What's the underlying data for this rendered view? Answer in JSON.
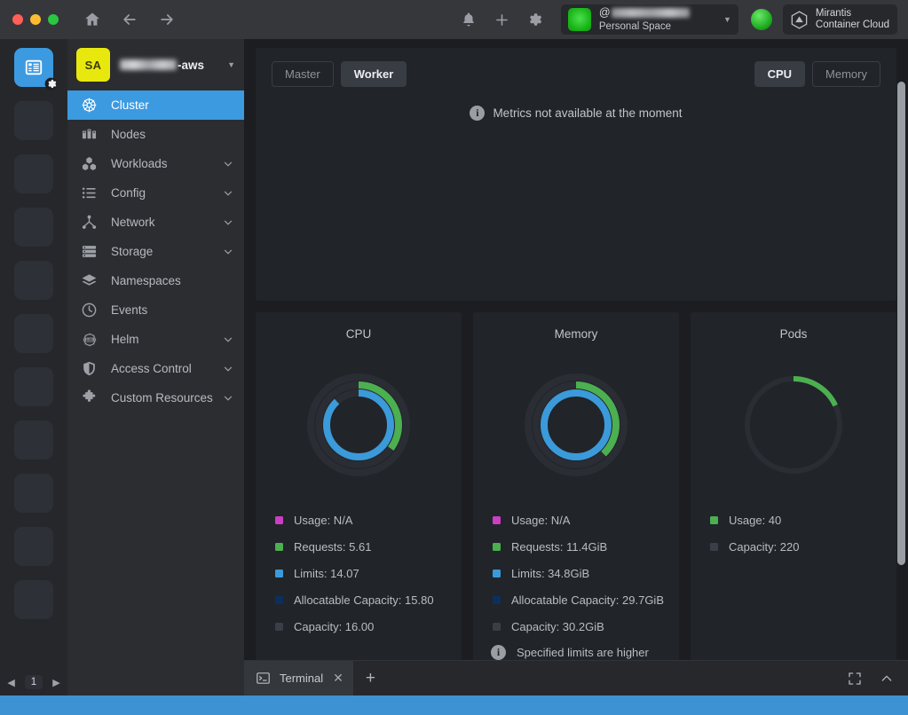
{
  "titlebar": {
    "nav": [
      {
        "name": "home-icon",
        "label": "Home"
      },
      {
        "name": "back-icon",
        "label": "Back"
      },
      {
        "name": "forward-icon",
        "label": "Forward"
      }
    ],
    "icons": [
      {
        "name": "bell-icon",
        "label": "Notifications"
      },
      {
        "name": "plus-icon",
        "label": "Add"
      },
      {
        "name": "gear-icon",
        "label": "Preferences"
      }
    ],
    "workspace": {
      "at_symbol": "@",
      "user_masked": true,
      "subtitle": "Personal Space",
      "caret": "▼"
    },
    "brand": {
      "line1": "Mirantis",
      "line2": "Container Cloud"
    }
  },
  "rail": {
    "active_icon": "list-icon",
    "badge_icon": "gear-icon",
    "placeholder_count": 10,
    "pager": {
      "prev": "◀",
      "page": "1",
      "next": "▶"
    }
  },
  "sidebar": {
    "cluster": {
      "avatar_initials": "SA",
      "avatar_color": "#e8e80f",
      "name_suffix": "-aws",
      "caret": "▼"
    },
    "items": [
      {
        "label": "Cluster",
        "icon": "helm-wheel-icon",
        "active": true,
        "expandable": false
      },
      {
        "label": "Nodes",
        "icon": "nodes-icon",
        "active": false,
        "expandable": false
      },
      {
        "label": "Workloads",
        "icon": "workloads-icon",
        "active": false,
        "expandable": true
      },
      {
        "label": "Config",
        "icon": "config-list-icon",
        "active": false,
        "expandable": true
      },
      {
        "label": "Network",
        "icon": "network-icon",
        "active": false,
        "expandable": true
      },
      {
        "label": "Storage",
        "icon": "storage-icon",
        "active": false,
        "expandable": true
      },
      {
        "label": "Namespaces",
        "icon": "layers-icon",
        "active": false,
        "expandable": false
      },
      {
        "label": "Events",
        "icon": "clock-icon",
        "active": false,
        "expandable": false
      },
      {
        "label": "Helm",
        "icon": "helm-icon",
        "active": false,
        "expandable": true
      },
      {
        "label": "Access Control",
        "icon": "shield-icon",
        "active": false,
        "expandable": true
      },
      {
        "label": "Custom Resources",
        "icon": "puzzle-icon",
        "active": false,
        "expandable": true
      }
    ]
  },
  "main": {
    "node_tabs": [
      {
        "label": "Master",
        "active": false
      },
      {
        "label": "Worker",
        "active": true
      }
    ],
    "metric_tabs": [
      {
        "label": "CPU",
        "active": true
      },
      {
        "label": "Memory",
        "active": false
      }
    ],
    "empty_state": {
      "icon": "info-icon",
      "message": "Metrics not available at the moment"
    }
  },
  "chart_data": [
    {
      "type": "pie",
      "title": "CPU",
      "rings": [
        {
          "name": "Requests",
          "value": 5.61,
          "max": 16.0,
          "color": "#4caf50"
        },
        {
          "name": "Limits",
          "value": 14.07,
          "max": 16.0,
          "color": "#3b9ad9"
        }
      ],
      "legend": [
        {
          "label": "Usage: N/A",
          "color": "#cc3ec4"
        },
        {
          "label": "Requests: 5.61",
          "color": "#4caf50"
        },
        {
          "label": "Limits: 14.07",
          "color": "#3b9ad9"
        },
        {
          "label": "Allocatable Capacity: 15.80",
          "color": "#0d2f5e"
        },
        {
          "label": "Capacity: 16.00",
          "color": "#3a3f47"
        }
      ],
      "warning": null
    },
    {
      "type": "pie",
      "title": "Memory",
      "rings": [
        {
          "name": "Requests",
          "value": 11.4,
          "max": 30.2,
          "color": "#4caf50"
        },
        {
          "name": "Limits",
          "value": 34.8,
          "max": 30.2,
          "color": "#3b9ad9"
        }
      ],
      "legend": [
        {
          "label": "Usage: N/A",
          "color": "#cc3ec4"
        },
        {
          "label": "Requests: 11.4GiB",
          "color": "#4caf50"
        },
        {
          "label": "Limits: 34.8GiB",
          "color": "#3b9ad9"
        },
        {
          "label": "Allocatable Capacity: 29.7GiB",
          "color": "#0d2f5e"
        },
        {
          "label": "Capacity: 30.2GiB",
          "color": "#3a3f47"
        }
      ],
      "warning": {
        "icon": "info-icon",
        "text": "Specified limits are higher than node capacity!"
      }
    },
    {
      "type": "pie",
      "title": "Pods",
      "rings": [
        {
          "name": "Usage",
          "value": 40,
          "max": 220,
          "color": "#4caf50"
        }
      ],
      "legend": [
        {
          "label": "Usage: 40",
          "color": "#4caf50"
        },
        {
          "label": "Capacity: 220",
          "color": "#3a3f47"
        }
      ],
      "warning": null
    }
  ],
  "terminal": {
    "tab_icon": "terminal-icon",
    "tab_label": "Terminal",
    "close": "✕",
    "add": "+",
    "fullscreen_icon": "fullscreen-icon",
    "collapse_icon": "chevron-up-icon"
  }
}
